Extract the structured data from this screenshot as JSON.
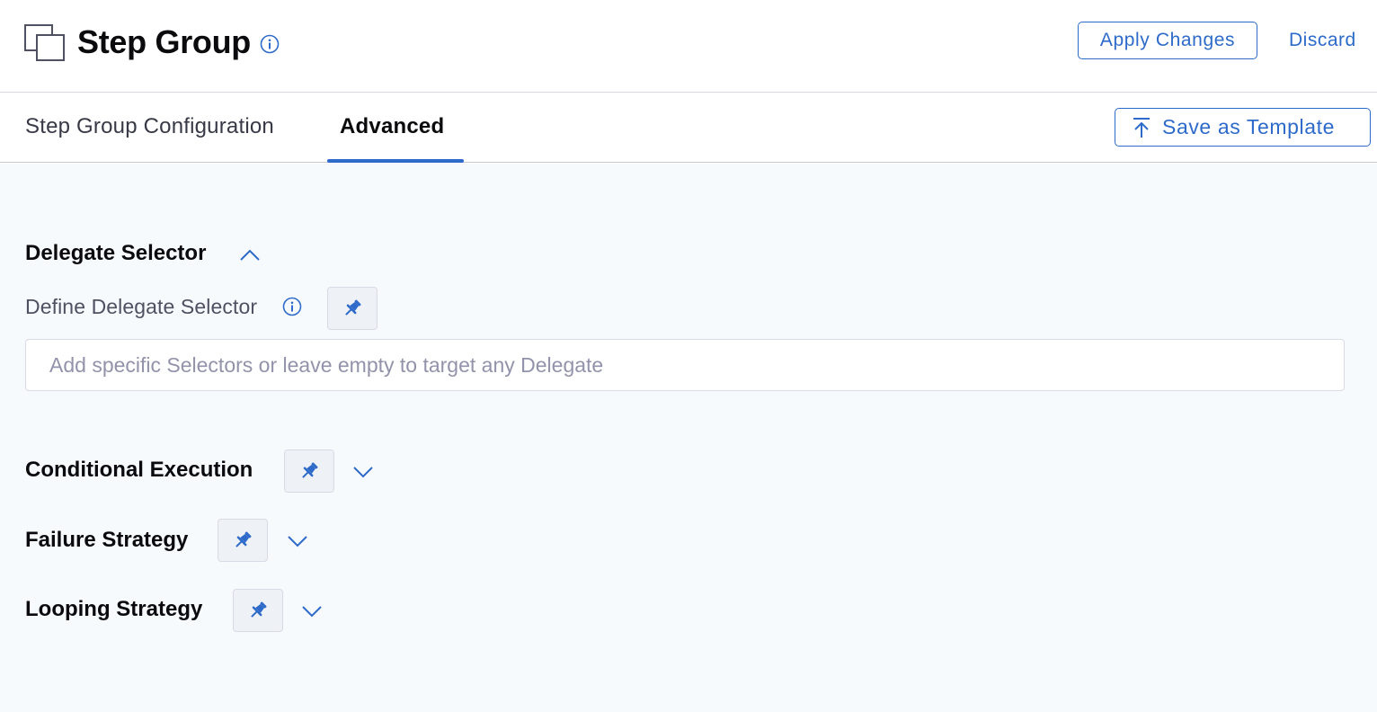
{
  "header": {
    "title": "Step Group",
    "icon": "step-group-icon",
    "apply_label": "Apply Changes",
    "discard_label": "Discard"
  },
  "tabs": [
    {
      "label": "Step Group Configuration",
      "active": false
    },
    {
      "label": "Advanced",
      "active": true
    }
  ],
  "save_template_label": "Save as Template",
  "sections": {
    "delegate_selector": {
      "title": "Delegate Selector",
      "expanded": true,
      "field_label": "Define Delegate Selector",
      "input_placeholder": "Add specific Selectors or leave empty to target any Delegate",
      "input_value": ""
    },
    "conditional_execution": {
      "title": "Conditional Execution",
      "expanded": false
    },
    "failure_strategy": {
      "title": "Failure Strategy",
      "expanded": false
    },
    "looping_strategy": {
      "title": "Looping Strategy",
      "expanded": false
    }
  },
  "colors": {
    "accent": "#2d6ac9",
    "content_bg": "#f7fafd",
    "border": "#d9dae5"
  }
}
